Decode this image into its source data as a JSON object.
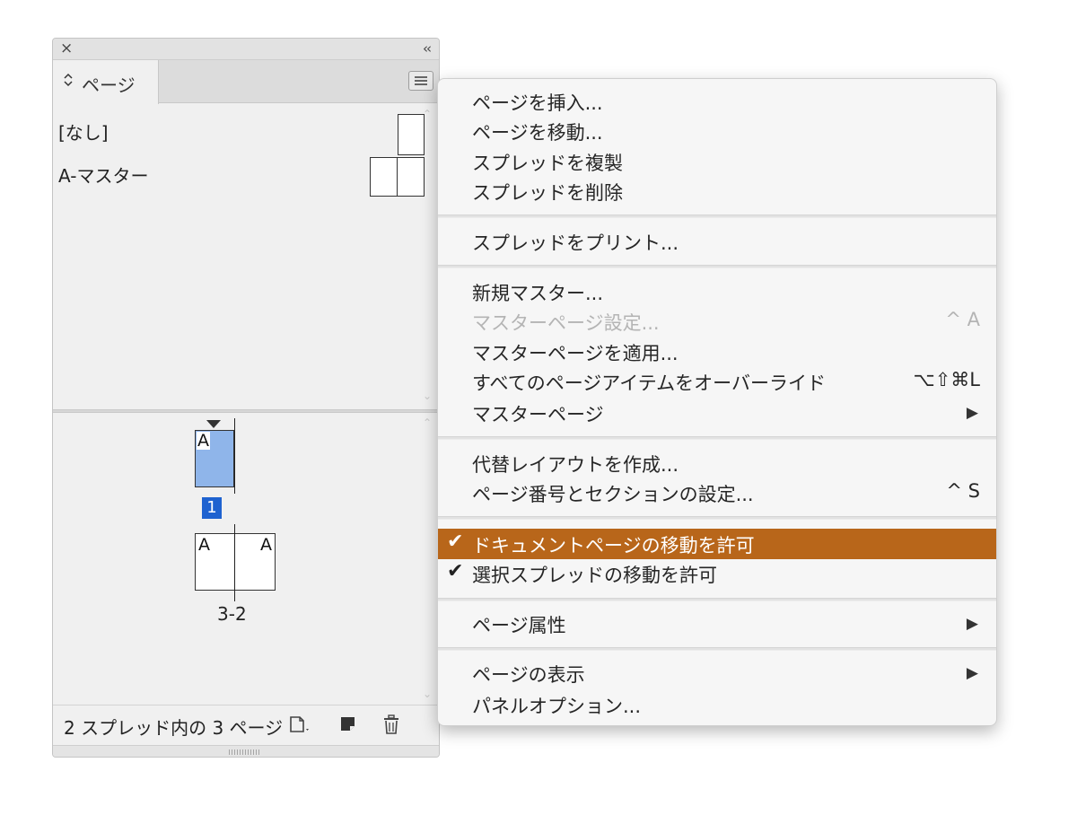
{
  "panel": {
    "close_icon": "×",
    "collapse_icon": "‹‹",
    "tab": {
      "arrows": "⌃⌄",
      "label": "ページ"
    },
    "masters": [
      {
        "label": "[なし]"
      },
      {
        "label": "A-マスター"
      }
    ],
    "pages": {
      "page1_letter": "A",
      "page1_number": "1",
      "spread_left_letter": "A",
      "spread_right_letter": "A",
      "spread_number": "3-2"
    },
    "footer": {
      "status": "2 スプレッド内の 3 ページ"
    },
    "colors": {
      "selected_page": "#8fb5ea",
      "selected_number_bg": "#1e62d0"
    }
  },
  "menu": {
    "items": [
      {
        "label": "ページを挿入..."
      },
      {
        "label": "ページを移動..."
      },
      {
        "label": "スプレッドを複製"
      },
      {
        "label": "スプレッドを削除"
      },
      {
        "label": "スプレッドをプリント..."
      },
      {
        "label": "新規マスター..."
      },
      {
        "label": "マスターページ設定...",
        "shortcut": "^ A",
        "disabled": true
      },
      {
        "label": "マスターページを適用..."
      },
      {
        "label": "すべてのページアイテムをオーバーライド",
        "shortcut": "⌥⇧⌘L"
      },
      {
        "label": "マスターページ",
        "submenu": "▶"
      },
      {
        "label": "代替レイアウトを作成..."
      },
      {
        "label": "ページ番号とセクションの設定...",
        "shortcut": "^ S"
      },
      {
        "label": "ドキュメントページの移動を許可",
        "check": "✔",
        "highlighted": true
      },
      {
        "label": "選択スプレッドの移動を許可",
        "check": "✔"
      },
      {
        "label": "ページ属性",
        "submenu": "▶"
      },
      {
        "label": "ページの表示",
        "submenu": "▶"
      },
      {
        "label": "パネルオプション..."
      }
    ],
    "colors": {
      "highlight": "#b8661a"
    }
  }
}
